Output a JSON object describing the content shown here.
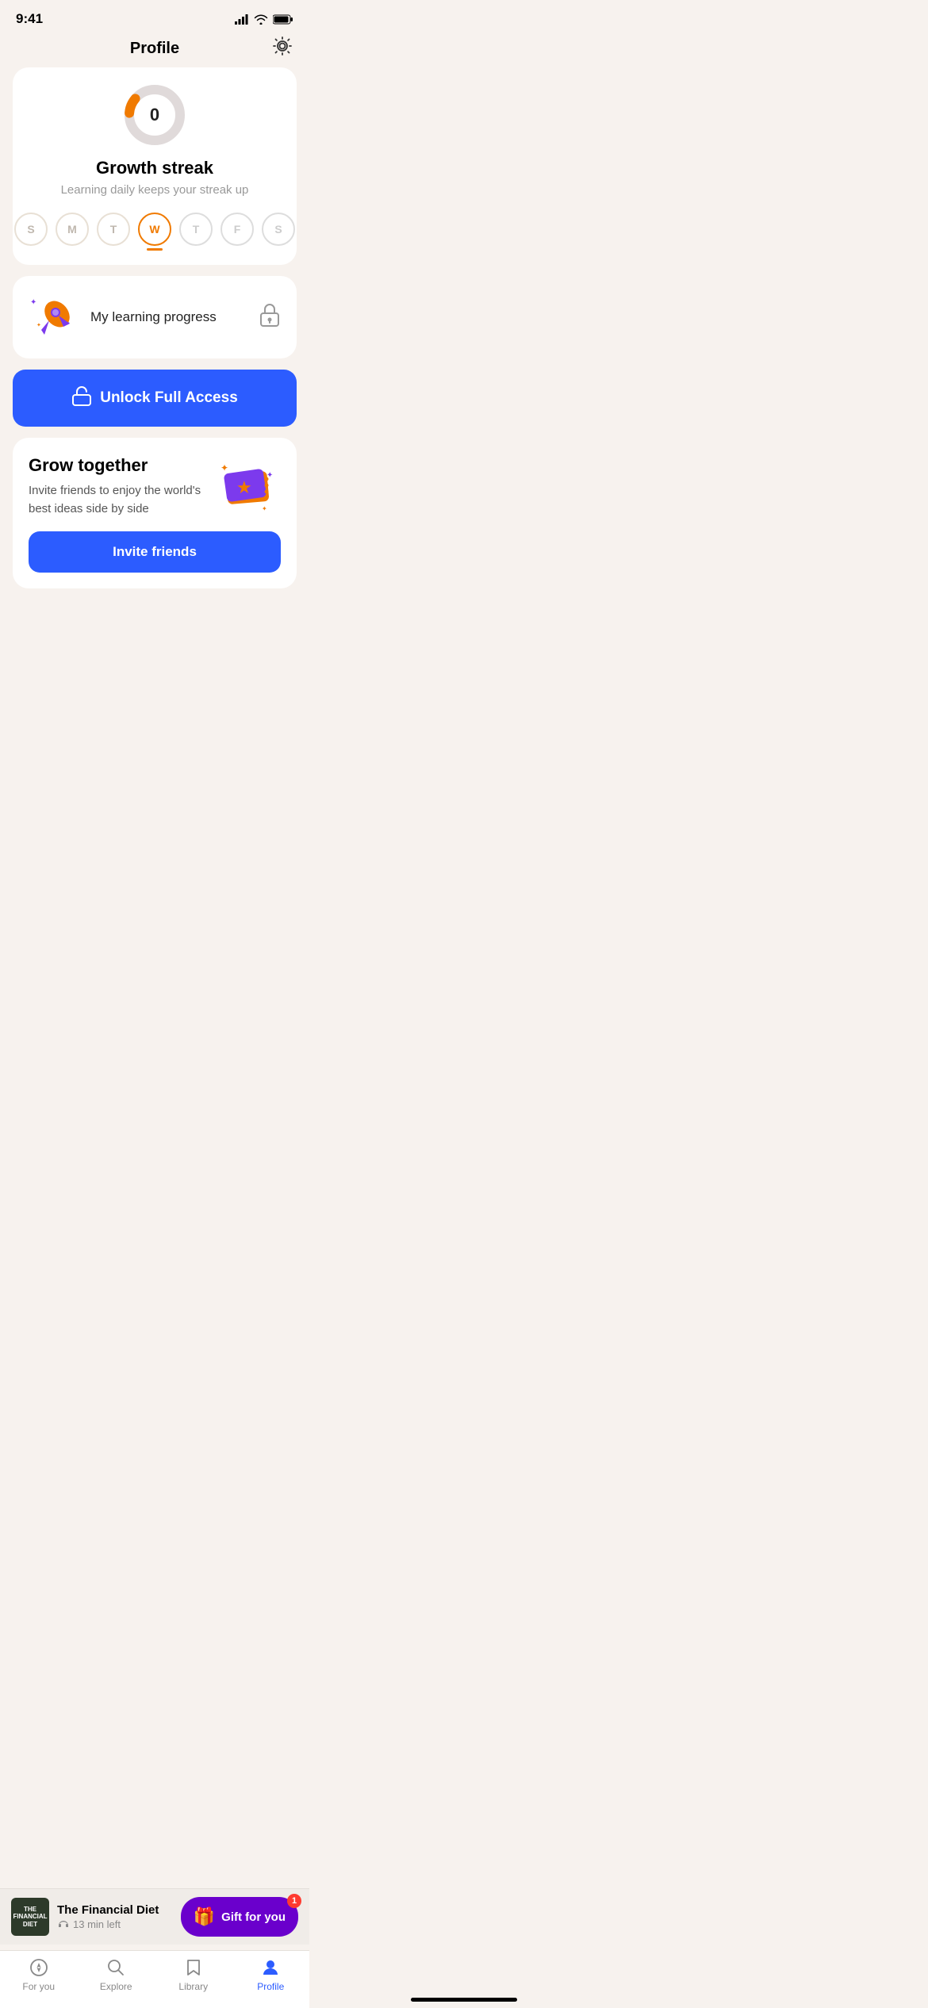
{
  "statusBar": {
    "time": "9:41"
  },
  "header": {
    "title": "Profile"
  },
  "streak": {
    "title": "Growth streak",
    "subtitle": "Learning daily keeps your streak up",
    "days": [
      {
        "label": "S",
        "state": "past"
      },
      {
        "label": "M",
        "state": "past"
      },
      {
        "label": "T",
        "state": "past"
      },
      {
        "label": "W",
        "state": "active"
      },
      {
        "label": "T",
        "state": "future"
      },
      {
        "label": "F",
        "state": "future"
      },
      {
        "label": "S",
        "state": "future"
      }
    ]
  },
  "learningProgress": {
    "label": "My learning progress"
  },
  "unlockButton": {
    "label": "Unlock Full Access"
  },
  "growTogether": {
    "title": "Grow together",
    "subtitle": "Invite friends to enjoy the world's best ideas side by side",
    "buttonLabel": "Invite friends"
  },
  "nowPlaying": {
    "title": "The Financial Diet",
    "timeLeft": "13 min left"
  },
  "giftButton": {
    "label": "Gift for you",
    "badge": "1"
  },
  "tabBar": {
    "items": [
      {
        "label": "For you",
        "icon": "compass",
        "active": false
      },
      {
        "label": "Explore",
        "icon": "search",
        "active": false
      },
      {
        "label": "Library",
        "icon": "bookmark",
        "active": false
      },
      {
        "label": "Profile",
        "icon": "person",
        "active": true
      }
    ]
  }
}
